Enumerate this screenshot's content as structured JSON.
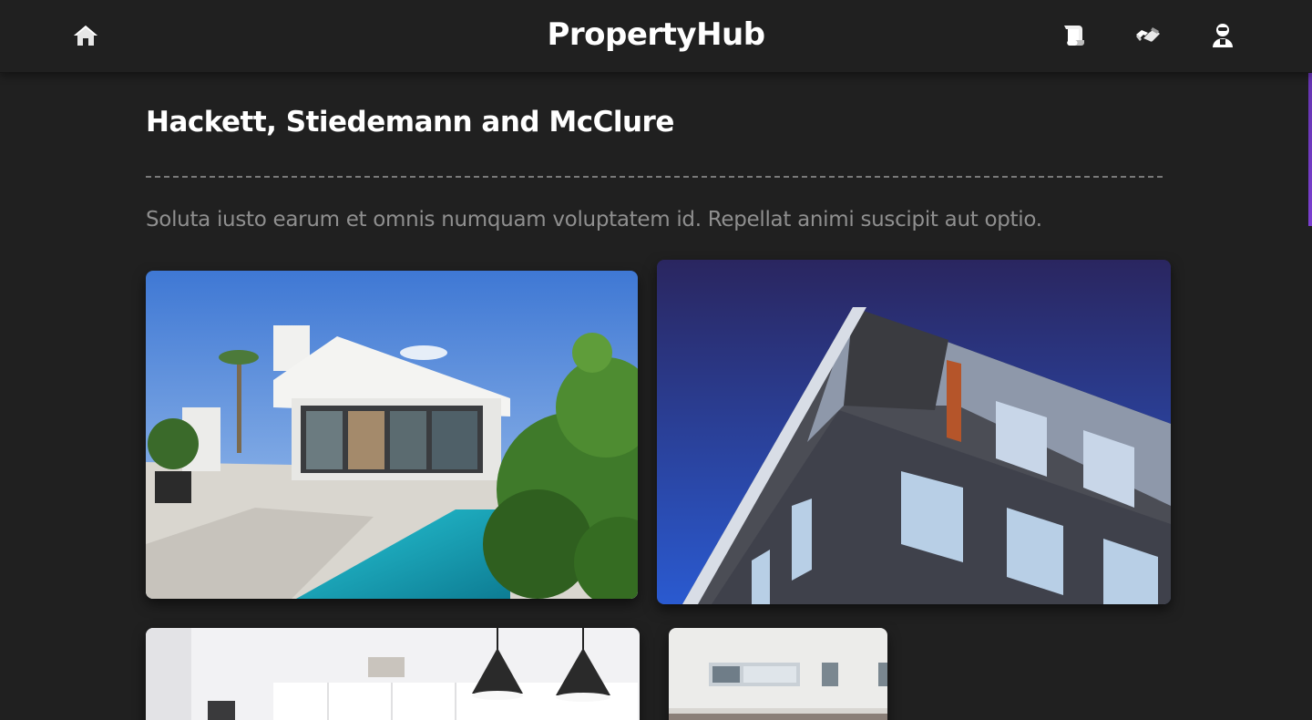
{
  "navbar": {
    "brand": "PropertyHub",
    "icons": [
      "home-icon",
      "scroll-icon",
      "handshake-icon",
      "user-icon"
    ]
  },
  "company": {
    "title": "Hackett, Stiedemann and McClure",
    "description": "Soluta iusto earum et omnis numquam voluptatem id. Repellat animi suscipit aut optio."
  },
  "colors": {
    "background": "#202020",
    "accent": "#6a35c0",
    "muted_text": "#8f8f8f"
  },
  "photos": [
    {
      "subject": "modern villa with pool"
    },
    {
      "subject": "brick apartment building corner"
    },
    {
      "subject": "kitchen with pendant lamps"
    },
    {
      "subject": "white building facade"
    }
  ]
}
